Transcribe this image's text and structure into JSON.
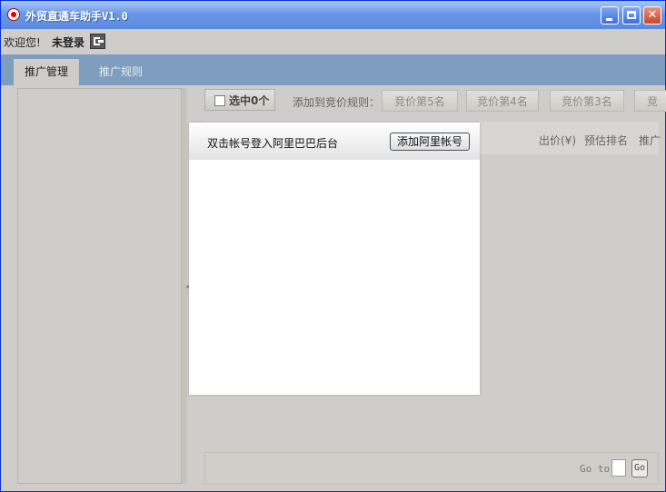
{
  "window": {
    "title": "外贸直通车助手V1.0",
    "controls": [
      "minimize",
      "maximize",
      "close"
    ]
  },
  "welcome": {
    "greeting": "欢迎您!",
    "status": "未登录"
  },
  "tabs": [
    {
      "label": "推广管理",
      "active": true
    },
    {
      "label": "推广规则",
      "active": false
    }
  ],
  "toolbar": {
    "select_label": "选中0个",
    "add_to_rule_label": "添加到竞价规则：",
    "rule_buttons": [
      "竞价第5名",
      "竞价第4名",
      "竞价第3名",
      "竞"
    ]
  },
  "grid": {
    "columns": [
      "出价(¥)",
      "预估排名",
      "推广"
    ]
  },
  "pagination": {
    "goto_label": "Go to",
    "go_button": "Go"
  },
  "popup": {
    "hint": "双击帐号登入阿里巴巴后台",
    "add_button": "添加阿里帐号"
  },
  "colors": {
    "titlebar": "#6a98e8",
    "tabbar": "#7f9ebf",
    "close_button": "#c9452b"
  }
}
